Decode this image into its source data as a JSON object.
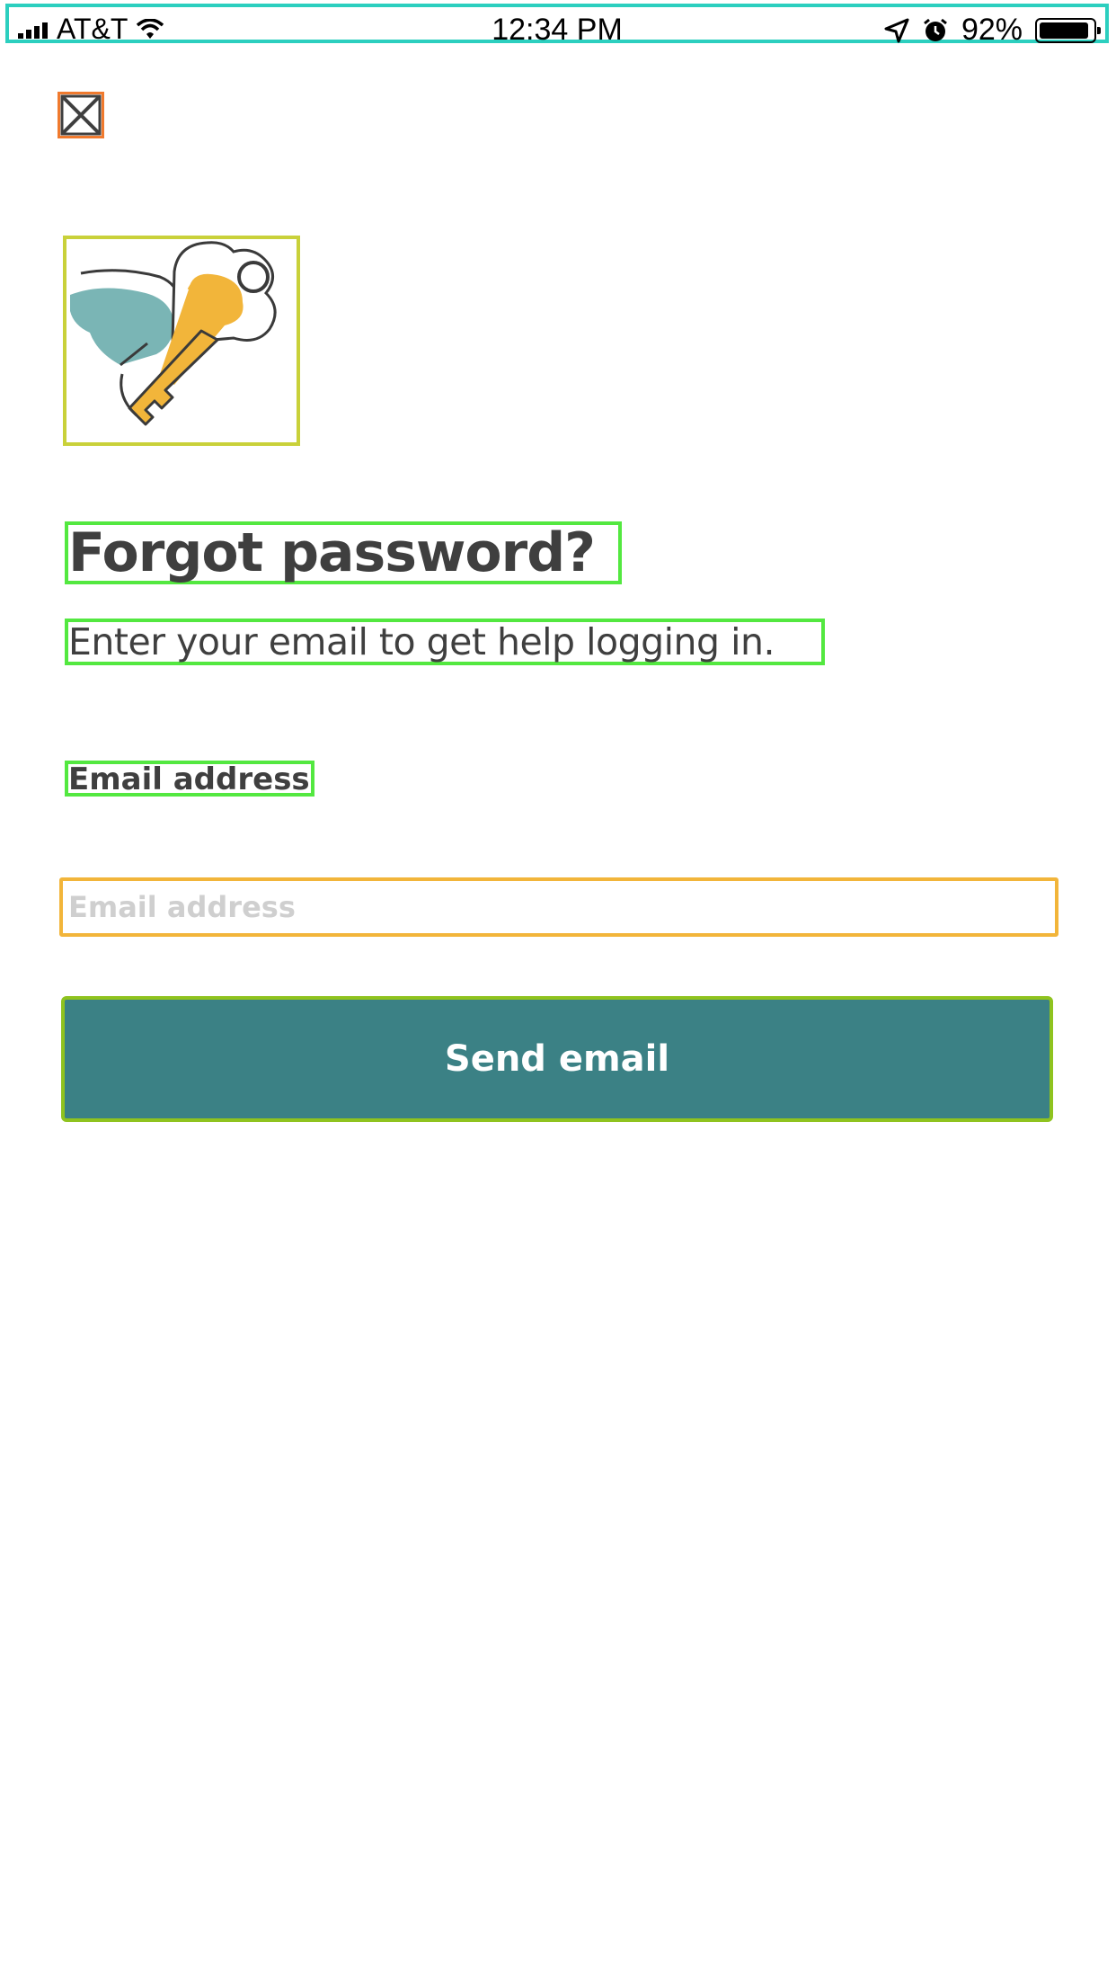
{
  "status_bar": {
    "carrier": "AT&T",
    "time": "12:34 PM",
    "battery_percent": "92%",
    "battery_level": 0.92,
    "icons": [
      "signal-icon",
      "wifi-icon",
      "location-icon",
      "alarm-icon",
      "battery-icon"
    ]
  },
  "header": {
    "close_icon": "close-icon"
  },
  "illustration": {
    "name": "winged-key-illustration",
    "colors": {
      "wing": "#7ab5b5",
      "key": "#f2b53a",
      "outline": "#3a3a3a"
    }
  },
  "content": {
    "title": "Forgot password?",
    "subtitle": "Enter your email to get help logging in.",
    "email_label": "Email address",
    "email_placeholder": "Email address",
    "email_value": ""
  },
  "actions": {
    "send_label": "Send email"
  },
  "colors": {
    "primary_button": "#3b8185",
    "text": "#3f3f3f",
    "placeholder": "#cfcfcf"
  }
}
